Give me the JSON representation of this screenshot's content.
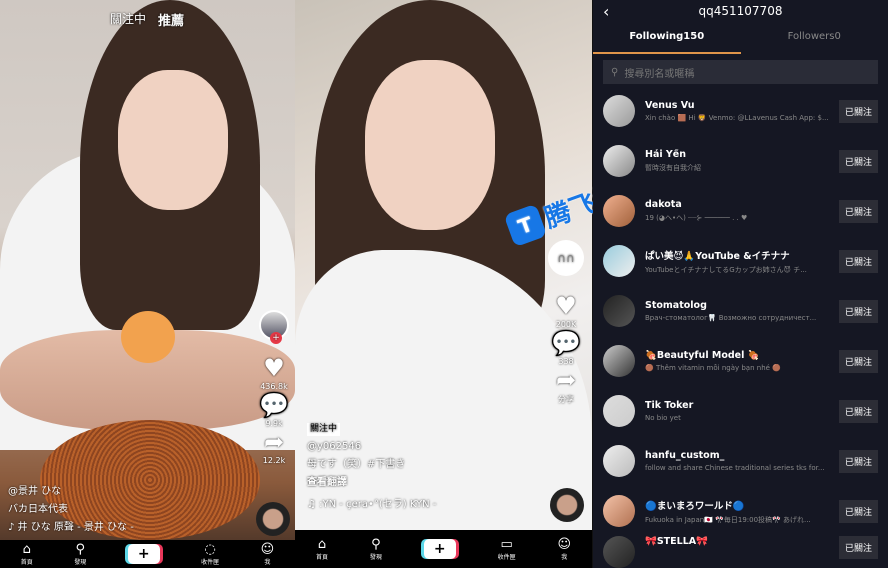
{
  "video1": {
    "tabs": [
      "關注中",
      "推薦"
    ],
    "likes": "436.8k",
    "comments": "9.9k",
    "shares": "12.2k",
    "username": "@景井 ひな",
    "description": "バカ日本代表",
    "sound": "♪ 井 ひな  原聲 - 景井 ひな -"
  },
  "video2": {
    "follow_tag": "關注中",
    "username": "@y062546",
    "description": "母です（笑）#下書き",
    "translate": "查看翻譯",
    "sound": "♫  :YN - çera•°(セラ)   KYN -",
    "likes": "200K",
    "comments": "338",
    "share_label": "分享"
  },
  "nav": {
    "home": "首頁",
    "discover": "發現",
    "inbox": "收件匣",
    "me": "我"
  },
  "watermark": "腾飞博客",
  "following": {
    "title": "qq451107708",
    "tabs": {
      "following": "Following150",
      "followers": "Followers0"
    },
    "search_placeholder": "搜尋別名或暱稱",
    "button_label": "已關注",
    "users": [
      {
        "name": "Venus Vu",
        "bio": "Xin chào 🟫 Hi 🦁 Venmo: @LLavenus Cash App: $..."
      },
      {
        "name": "Hải Yến",
        "bio": "暫時沒有自我介紹"
      },
      {
        "name": "dakota",
        "bio": "19 (◕ヘ•ヘ) ┈┈⊱ ────── . . ♥"
      },
      {
        "name": "ぱい美😈🙏YouTube &イチナナ",
        "bio": "YouTubeとイチナナしてるGカップお姉さん😈 チ..."
      },
      {
        "name": "Stomatolog",
        "bio": "Врач-стоматолог🦷 Возможно сотрудничест..."
      },
      {
        "name": "🍖Beautyful Model 🍖",
        "bio": "🟤 Thêm vitamin mỗi ngày bạn nhé 🟤"
      },
      {
        "name": "Tik Toker",
        "bio": "No bio yet"
      },
      {
        "name": "hanfu_custom_",
        "bio": "follow and share Chinese traditional series  tks for..."
      },
      {
        "name": "🔵まいまろワールド🔵",
        "bio": "Fukuoka in Japan🇯🇵 🎌毎日19:00投稿🎌 あげれ..."
      },
      {
        "name": "🎀ŠTELLA🎀",
        "bio": ""
      }
    ]
  }
}
